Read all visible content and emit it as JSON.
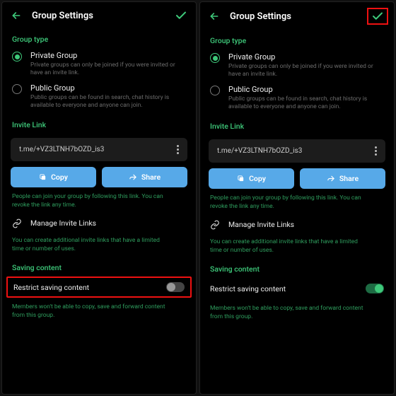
{
  "leftTitle": "Group Settings",
  "rightTitle": "Group Settings",
  "groupTypeHeader": "Group type",
  "privateLabel": "Private Group",
  "privateDesc": "Private groups can only be joined if you were invited or have an invite link.",
  "publicLabel": "Public Group",
  "publicDesc": "Public groups can be found in search, chat history is available to everyone and anyone can join.",
  "inviteHeader": "Invite Link",
  "inviteLink": "t.me/+VZ3LTNH7bOZD_is3",
  "copyLabel": "Copy",
  "shareLabel": "Share",
  "inviteHint": "People can join your group by following this link. You can revoke the link any time.",
  "manageLabel": "Manage Invite Links",
  "manageHint": "You can create additional invite links that have a limited time or number of uses.",
  "savingHeader": "Saving content",
  "restrictLabel": "Restrict saving content",
  "restrictHint": "Members won't be able to copy, save and forward content from this group."
}
